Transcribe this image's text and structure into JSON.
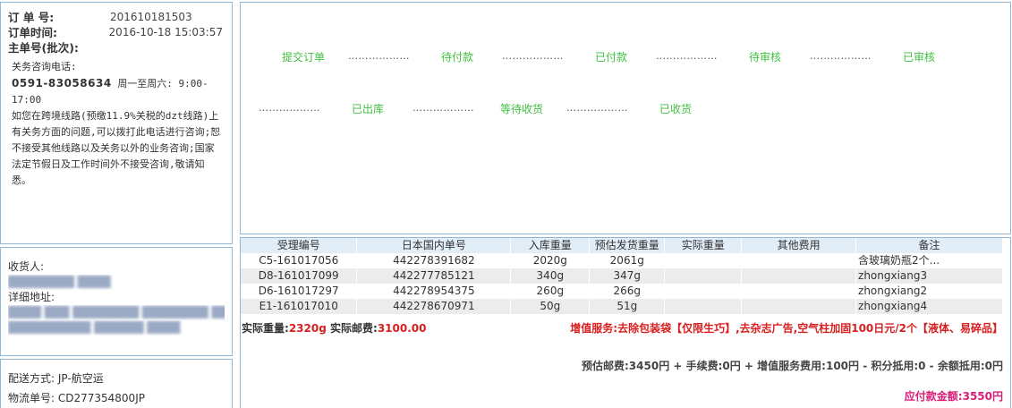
{
  "order": {
    "number_label": "订 单 号:",
    "number_value": "201610181503",
    "time_label": "订单时间:",
    "time_value": "2016-10-18 15:03:57",
    "master_label": "主单号(批次):",
    "notice_title": "关务咨询电话:",
    "notice_phone": "0591-83058634",
    "notice_hours": "周一至周六: 9:00-17:00",
    "notice_body": "如您在跨境线路(预缴11.9%关税的dzt线路)上有关务方面的问题,可以拨打此电话进行咨询;恕不接受其他线路以及关务以外的业务咨询;国家法定节假日及工作时间外不接受咨询,敬请知悉。"
  },
  "receiver": {
    "name_label": "收货人:",
    "address_label": "详细地址:"
  },
  "shipping": {
    "method": "配送方式: JP-航空运",
    "tracking": "物流单号: CD277354800JP"
  },
  "progress": {
    "steps": [
      "提交订单",
      "待付款",
      "已付款",
      "待审核",
      "已审核",
      "已出库",
      "等待收货",
      "已收货"
    ],
    "separator": "………………"
  },
  "items": {
    "columns": [
      "受理编号",
      "日本国内单号",
      "入库重量",
      "预估发货重量",
      "实际重量",
      "其他费用",
      "备注"
    ],
    "rows": [
      [
        "C5-161017056",
        "442278391682",
        "2020g",
        "2061g",
        "",
        "",
        "含玻璃奶瓶2个..."
      ],
      [
        "D8-161017099",
        "442277785121",
        "340g",
        "347g",
        "",
        "",
        "zhongxiang3"
      ],
      [
        "D6-161017297",
        "442278954375",
        "260g",
        "266g",
        "",
        "",
        "zhongxiang2"
      ],
      [
        "E1-161017010",
        "442278670971",
        "50g",
        "51g",
        "",
        "",
        "zhongxiang4"
      ]
    ],
    "actual_weight_label": "实际重量:",
    "actual_weight_value": "2320g",
    "actual_postage_label": "实际邮费:",
    "actual_postage_value": "3100.00",
    "value_added": "增值服务:去除包装袋【仅限生巧】,去杂志广告,空气柱加固100日元/2个【液体、易碎品】",
    "fee_breakdown": "预估邮费:3450円 + 手续费:0円 + 增值服务费用:100円 - 积分抵用:0 - 余额抵用:0円",
    "total": "应付款金额:3550円"
  },
  "colors": {
    "border": "#8fb8d8",
    "step_green": "#40c040",
    "header_bg": "#e1edf7",
    "alert_red": "#d81e1e",
    "total_pink": "#d81e78"
  }
}
